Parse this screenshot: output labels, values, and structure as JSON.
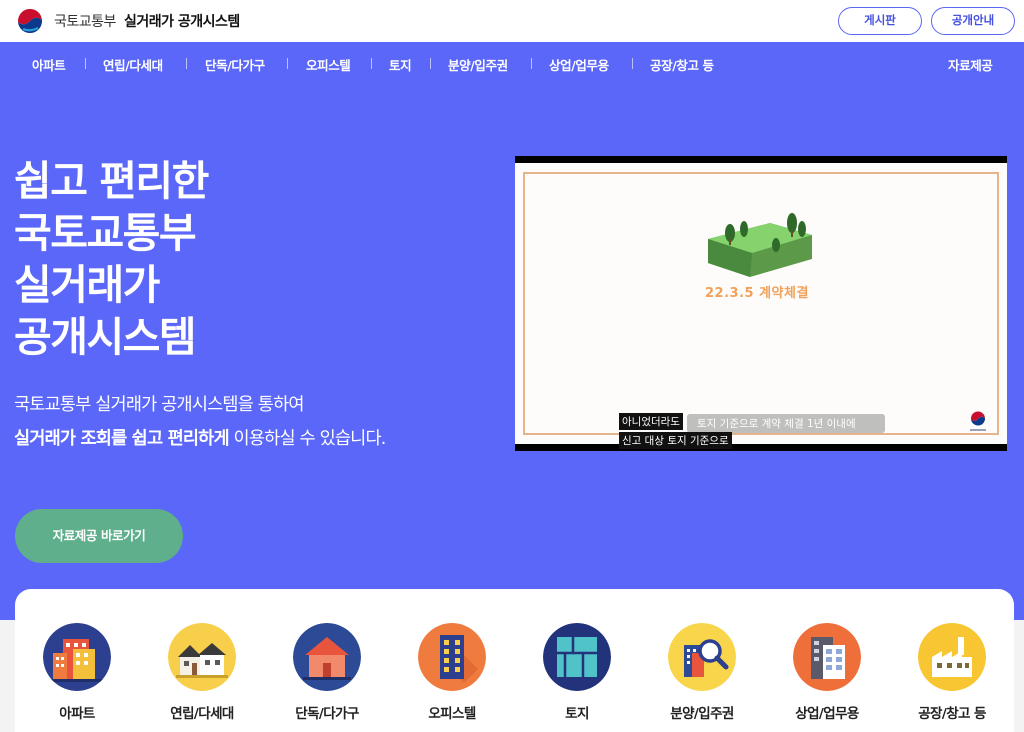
{
  "header": {
    "ministry": "국토교통부",
    "system": "실거래가 공개시스템",
    "board_button": "게시판",
    "notice_button": "공개안내"
  },
  "nav": {
    "items": [
      "아파트",
      "연립/다세대",
      "단독/다가구",
      "오피스텔",
      "토지",
      "분양/입주권",
      "상업/업무용",
      "공장/창고 등"
    ],
    "right_item": "자료제공"
  },
  "hero": {
    "title_lines": [
      "쉽고 편리한",
      "국토교통부",
      "실거래가",
      "공개시스템"
    ],
    "desc_line1": "국토교통부 실거래가 공개시스템을 통하여",
    "desc_line2_bold": "실거래가 조회를 쉽고 편리하게",
    "desc_line2_rest": " 이용하실 수 있습니다.",
    "cta": "자료제공 바로가기"
  },
  "video": {
    "date_text": "22.3.5 계약체결",
    "caption_bg": "토지 기준으로 계약 체결 1년 이내에",
    "caption_line1": "아니었더라도",
    "caption_line2": "신고 대상 토지 기준으로"
  },
  "categories": [
    {
      "label": "아파트",
      "icon": "apartment-icon",
      "bg": "#2d3f8f"
    },
    {
      "label": "연립/다세대",
      "icon": "row-house-icon",
      "bg": "#f7cf4a"
    },
    {
      "label": "단독/다가구",
      "icon": "detached-house-icon",
      "bg": "#2d4a96"
    },
    {
      "label": "오피스텔",
      "icon": "officetel-icon",
      "bg": "#f07b3f"
    },
    {
      "label": "토지",
      "icon": "land-icon",
      "bg": "#22337c"
    },
    {
      "label": "분양/입주권",
      "icon": "presale-search-icon",
      "bg": "#f8d54a"
    },
    {
      "label": "상업/업무용",
      "icon": "commercial-building-icon",
      "bg": "#ef6f3a"
    },
    {
      "label": "공장/창고 등",
      "icon": "factory-icon",
      "bg": "#f7c632"
    }
  ],
  "colors": {
    "hero_bg": "#5b67f8",
    "cta_bg": "#5fae8c",
    "header_button_border": "#5a67f5"
  }
}
